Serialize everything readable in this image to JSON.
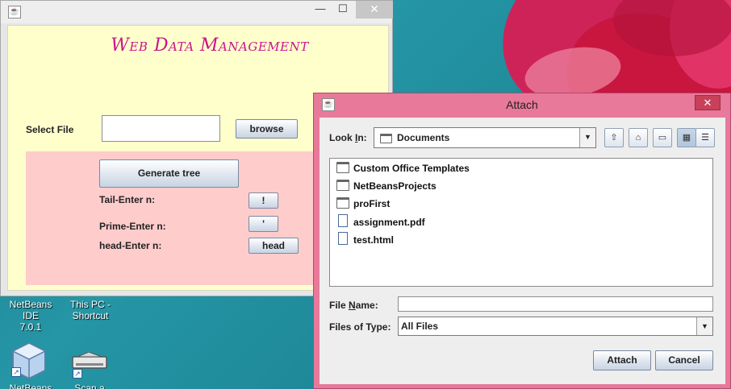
{
  "main_window": {
    "title": "",
    "minimize_glyph": "—",
    "maximize_glyph": "☐",
    "close_glyph": "✕",
    "app_title": "Web Data Management",
    "select_file_label": "Select File",
    "file_path_value": "",
    "browse_label": "browse",
    "generate_tree_label": "Generate tree",
    "tail_label": "Tail-Enter n:",
    "tail_button": "!",
    "prime_label": "Prime-Enter n:",
    "prime_button": "'",
    "head_label": "head-Enter n:",
    "head_button": "head",
    "colors": {
      "title": "#c8148c",
      "content_bg": "#ffffcc",
      "panel_bg": "#ffcccc"
    }
  },
  "desktop": {
    "icons": [
      {
        "label_line1": "NetBeans IDE",
        "label_line2": "7.0.1",
        "icon": "netbeans-cube-icon"
      },
      {
        "label_line1": "This PC -",
        "label_line2": "Shortcut",
        "icon": "this-pc-icon"
      },
      {
        "label_line1": "NetBeans IDE",
        "icon": "netbeans-cube-icon"
      },
      {
        "label_line1": "Scan a",
        "icon": "scanner-icon"
      }
    ]
  },
  "dialog": {
    "title": "Attach",
    "close_glyph": "✕",
    "look_in_label_pre": "Look ",
    "look_in_label_u": "I",
    "look_in_label_post": "n:",
    "look_in_value": "Documents",
    "files": [
      {
        "name": "Custom Office Templates",
        "type": "folder"
      },
      {
        "name": "NetBeansProjects",
        "type": "folder"
      },
      {
        "name": "proFirst",
        "type": "folder"
      },
      {
        "name": "assignment.pdf",
        "type": "file"
      },
      {
        "name": "test.html",
        "type": "file"
      }
    ],
    "file_name_label_pre": "File ",
    "file_name_label_u": "N",
    "file_name_label_post": "ame:",
    "file_name_value": "",
    "files_of_type_label": "Files of Type:",
    "files_of_type_value": "All Files",
    "attach_label": "Attach",
    "cancel_label": "Cancel",
    "colors": {
      "frame": "#e8799b",
      "close": "#c8405a"
    }
  }
}
